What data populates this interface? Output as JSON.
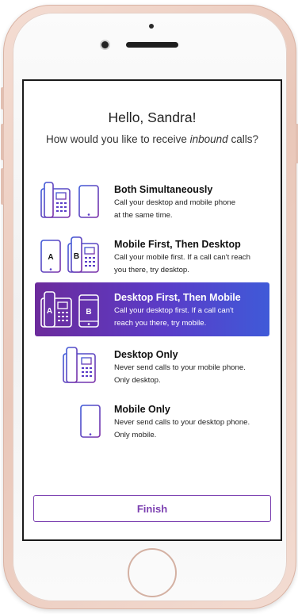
{
  "greeting": "Hello, Sandra!",
  "question": {
    "prefix": "How would you like to receive ",
    "emphasis": "inbound",
    "suffix": " calls?"
  },
  "options": [
    {
      "title": "Both Simultaneously",
      "desc_line1": "Call your desktop and mobile phone",
      "desc_line2": "at the same time.",
      "icon": "desktop-and-mobile-icon",
      "selected": false
    },
    {
      "title": "Mobile First, Then Desktop",
      "desc_line1": "Call your mobile first. If a call can't reach",
      "desc_line2": "you there, try desktop.",
      "icon": "mobile-then-desktop-icon",
      "badge_a": "A",
      "badge_b": "B",
      "selected": false
    },
    {
      "title": "Desktop First, Then Mobile",
      "desc_line1": "Call your desktop first. If a call can't",
      "desc_line2": "reach you there, try mobile.",
      "icon": "desktop-then-mobile-icon",
      "badge_a": "A",
      "badge_b": "B",
      "selected": true
    },
    {
      "title": "Desktop Only",
      "desc_line1": "Never send calls to your mobile phone.",
      "desc_line2": "Only desktop.",
      "icon": "desk-phone-icon",
      "selected": false
    },
    {
      "title": "Mobile Only",
      "desc_line1": "Never send calls to your desktop phone.",
      "desc_line2": "Only mobile.",
      "icon": "mobile-phone-icon",
      "selected": false
    }
  ],
  "finish_label": "Finish",
  "colors": {
    "accent_purple": "#7b3fb0",
    "gradient_start": "#6c2b9c",
    "gradient_end": "#3f5ad8",
    "icon_stroke": "#6a3aa8"
  }
}
